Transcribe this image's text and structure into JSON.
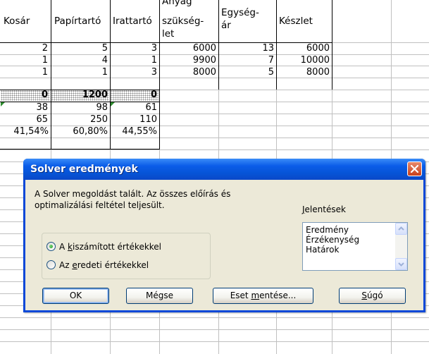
{
  "spreadsheet": {
    "headers": {
      "kosar": "Kosár",
      "papirtarto": "Papírtartó",
      "irattarto": "Irattartó",
      "anyag_line1": "Anyag",
      "anyag_line2": "szükség-",
      "anyag_line3": "let",
      "egyseg_line1": "Egység-",
      "egyseg_line2": "ár",
      "keszlet": "Készlet"
    },
    "rows": [
      [
        "2",
        "5",
        "3",
        "6000",
        "13",
        "6000"
      ],
      [
        "1",
        "4",
        "1",
        "9900",
        "7",
        "10000"
      ],
      [
        "1",
        "1",
        "3",
        "8000",
        "5",
        "8000"
      ]
    ],
    "variable_row": [
      "0",
      "1200",
      "0"
    ],
    "row_a": [
      "38",
      "98",
      "61"
    ],
    "row_b": [
      "65",
      "250",
      "110"
    ],
    "row_c": [
      "41,54%",
      "60,80%",
      "44,55%"
    ]
  },
  "dialog": {
    "title": "Solver eredmények",
    "message_line1": "A Solver megoldást talált. Az összes előírás és",
    "message_line2": "optimalizálási feltétel teljesült.",
    "reports_label_accel": "J",
    "reports_label_rest": "elentések",
    "reports": [
      "Eredmény",
      "Érzékenység",
      "Határok"
    ],
    "radio_keep": {
      "pre": "A ",
      "accel": "k",
      "post": "iszámított értékekkel",
      "selected": true
    },
    "radio_restore": {
      "pre": "Az ",
      "accel": "e",
      "post": "redeti értékekkel",
      "selected": false
    },
    "buttons": {
      "ok": "OK",
      "cancel": "Mégse",
      "save_pre": "Eset ",
      "save_accel": "m",
      "save_post": "entése...",
      "help_accel": "S",
      "help_post": "úgó"
    },
    "colors": {
      "titlebar": "#0a5ce8",
      "client": "#ece9d8",
      "close": "#c8401c"
    }
  }
}
